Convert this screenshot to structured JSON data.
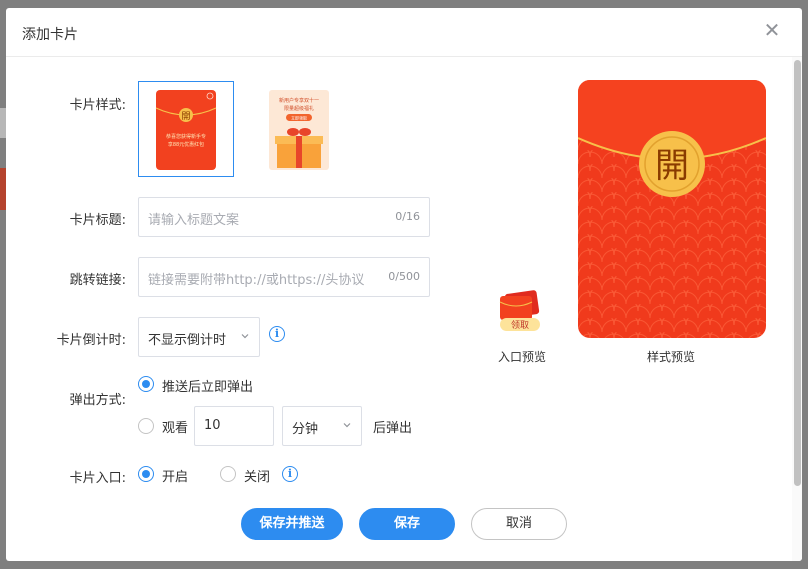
{
  "dialog": {
    "title": "添加卡片",
    "close_glyph": "✕"
  },
  "form": {
    "style_label": "卡片样式:",
    "title_label": "卡片标题:",
    "title_placeholder": "请输入标题文案",
    "title_count": "0/16",
    "link_label": "跳转链接:",
    "link_placeholder": "链接需要附带http://或https://头协议",
    "link_count": "0/500",
    "countdown_label": "卡片倒计时:",
    "countdown_value": "不显示倒计时",
    "popup_label": "弹出方式:",
    "popup_option_immediate": "推送后立即弹出",
    "popup_option_watch_prefix": "观看",
    "popup_watch_value": "10",
    "popup_watch_unit": "分钟",
    "popup_option_watch_suffix": "后弹出",
    "entry_label": "卡片入口:",
    "entry_on": "开启",
    "entry_off": "关闭",
    "info_glyph": "i"
  },
  "style_options": [
    {
      "name": "red-envelope",
      "selected": true,
      "seal": "開",
      "text_lines": [
        "恭喜您获得新手专",
        "享88元优惠红包"
      ]
    },
    {
      "name": "gift-box",
      "selected": false,
      "text_lines": [
        "新用户专享双十一",
        "限量超级福礼"
      ],
      "button_text": "立即领取"
    }
  ],
  "preview": {
    "entry_caption": "入口预览",
    "entry_badge": "领取",
    "style_caption": "样式预览",
    "seal": "開"
  },
  "buttons": {
    "save_push": "保存并推送",
    "save": "保存",
    "cancel": "取消"
  },
  "colors": {
    "accent": "#2d8cf0",
    "envelope_red": "#f2411f",
    "seal_gold": "#f7c04a"
  }
}
